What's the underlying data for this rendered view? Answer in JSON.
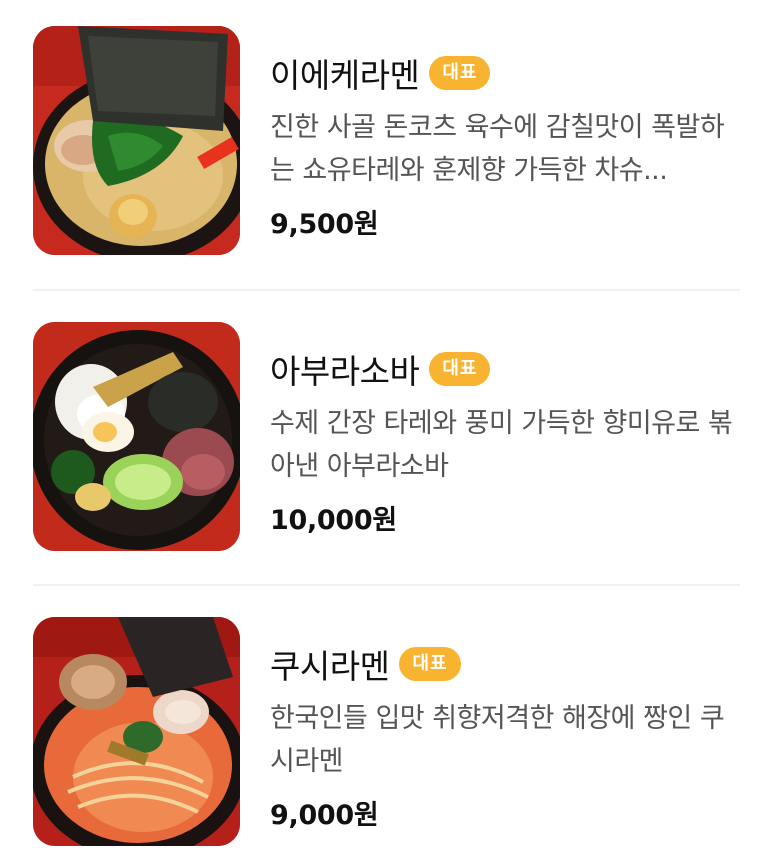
{
  "menu": {
    "items": [
      {
        "name": "이에케라멘",
        "badge": "대표",
        "description": "진한 사골 돈코츠 육수에 감칠맛이 폭발하는 쇼유타레와 훈제향 가득한 차슈...",
        "price": "9,500원",
        "photo": "ramen-bowl-seaweed-egg-spinach"
      },
      {
        "name": "아부라소바",
        "badge": "대표",
        "description": "수제 간장 타레와 풍미 가득한 향미유로 볶아낸 아부라소바",
        "price": "10,000원",
        "photo": "abura-soba-bowl-toppings"
      },
      {
        "name": "쿠시라멘",
        "badge": "대표",
        "description": "한국인들 입맛 취향저격한 해장에 짱인 쿠시라멘",
        "price": "9,000원",
        "photo": "spicy-ramen-bowl-noodles"
      }
    ]
  },
  "colors": {
    "badge": "#f8b431",
    "title": "#111111",
    "description": "#555555",
    "price": "#111111",
    "divider": "#f1f1f1"
  }
}
